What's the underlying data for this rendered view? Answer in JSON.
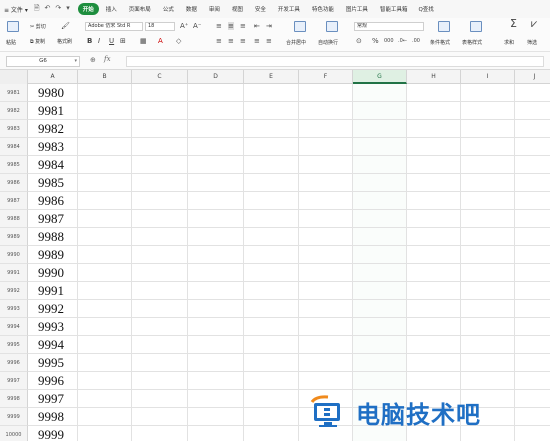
{
  "menubar": {
    "file_label": "≡ 文件 ▾",
    "tabs": [
      {
        "label": "开始",
        "active": true
      },
      {
        "label": "插入",
        "active": false
      },
      {
        "label": "页面布局",
        "active": false
      },
      {
        "label": "公式",
        "active": false
      },
      {
        "label": "数据",
        "active": false
      },
      {
        "label": "审阅",
        "active": false
      },
      {
        "label": "视图",
        "active": false
      },
      {
        "label": "安全",
        "active": false
      },
      {
        "label": "开发工具",
        "active": false
      },
      {
        "label": "特色功能",
        "active": false
      },
      {
        "label": "图片工具",
        "active": false
      },
      {
        "label": "智能工具箱",
        "active": false
      }
    ],
    "search_label": "Q查找"
  },
  "ribbon": {
    "paste": "粘贴",
    "cut": "剪切",
    "copy": "复制",
    "format_painter": "格式刷",
    "font_name": "Adobe 仿宋 Std R",
    "font_size": "18",
    "number_format": "常规",
    "merge_center": "合并居中",
    "wrap_text": "自动换行",
    "conditional_format": "条件格式",
    "table_style": "表格样式",
    "sum": "求和",
    "filter": "筛选"
  },
  "formula_bar": {
    "cell_ref": "G6",
    "formula": ""
  },
  "columns": [
    "A",
    "B",
    "C",
    "D",
    "E",
    "F",
    "G",
    "H",
    "I",
    "J"
  ],
  "selected_column": "G",
  "rows": [
    {
      "num": "9981",
      "a": "9980"
    },
    {
      "num": "9982",
      "a": "9981"
    },
    {
      "num": "9983",
      "a": "9982"
    },
    {
      "num": "9984",
      "a": "9983"
    },
    {
      "num": "9985",
      "a": "9984"
    },
    {
      "num": "9986",
      "a": "9985"
    },
    {
      "num": "9987",
      "a": "9986"
    },
    {
      "num": "9988",
      "a": "9987"
    },
    {
      "num": "9989",
      "a": "9988"
    },
    {
      "num": "9990",
      "a": "9989"
    },
    {
      "num": "9991",
      "a": "9990"
    },
    {
      "num": "9992",
      "a": "9991"
    },
    {
      "num": "9993",
      "a": "9992"
    },
    {
      "num": "9994",
      "a": "9993"
    },
    {
      "num": "9995",
      "a": "9994"
    },
    {
      "num": "9996",
      "a": "9995"
    },
    {
      "num": "9997",
      "a": "9996"
    },
    {
      "num": "9998",
      "a": "9997"
    },
    {
      "num": "9999",
      "a": "9998"
    },
    {
      "num": "10000",
      "a": "9999"
    }
  ],
  "watermark": {
    "text": "电脑技术吧",
    "color": "#1f6fc4"
  },
  "colors": {
    "accent_green": "#1e8e3e",
    "selection_green": "#217346"
  }
}
